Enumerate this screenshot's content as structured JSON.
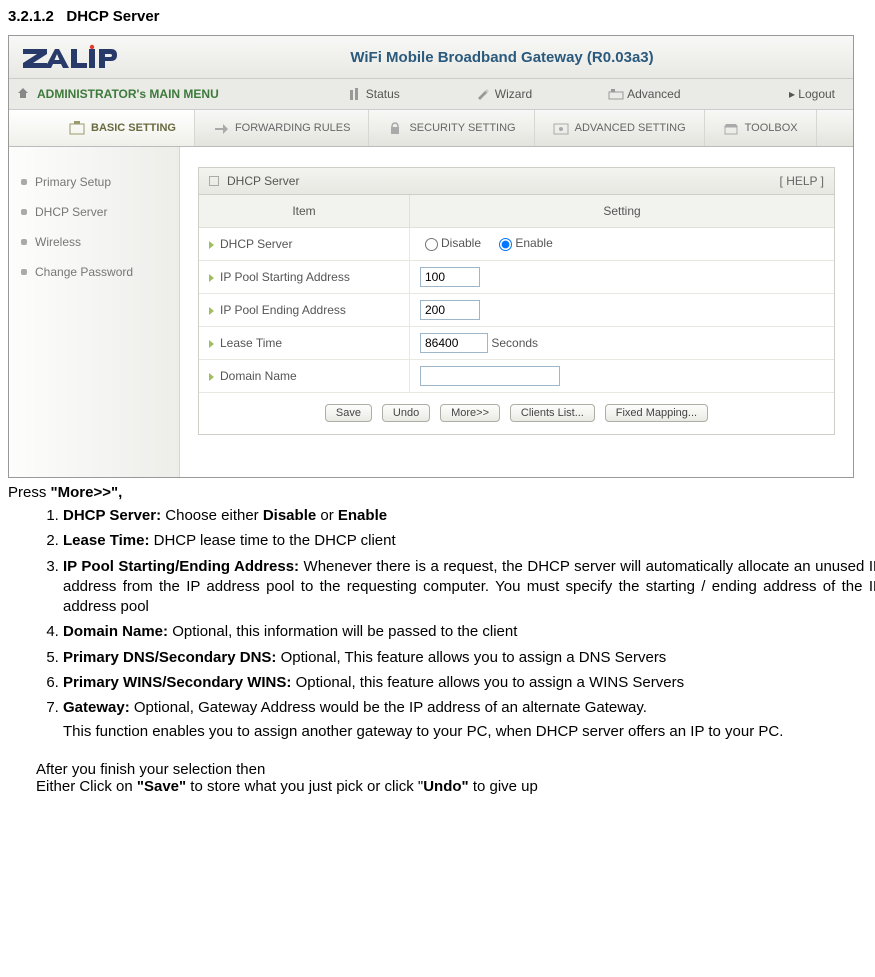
{
  "doc": {
    "section_number": "3.2.1.2",
    "section_name": "DHCP Server",
    "press_prefix": "Press ",
    "press_bold": "\"More>>\",",
    "items": [
      {
        "bold": "DHCP Server:",
        "rest": " Choose either ",
        "bold2": "Disable",
        "mid": " or ",
        "bold3": "Enable"
      },
      {
        "bold": "Lease Time:",
        "rest": " DHCP lease time to the DHCP client"
      },
      {
        "bold": "IP Pool Starting/Ending Address:",
        "rest": " Whenever there is a request, the DHCP server will automatically allocate an unused IP address from the IP address pool to the requesting computer. You must specify the starting / ending address of the IP address pool"
      },
      {
        "bold": "Domain Name:",
        "rest": " Optional, this information will be passed to the client"
      },
      {
        "bold": "Primary DNS/Secondary DNS:",
        "rest": " Optional, This feature allows you to assign a DNS Servers"
      },
      {
        "bold": "Primary WINS/Secondary WINS:",
        "rest": " Optional, this feature allows you to assign a WINS Servers"
      },
      {
        "bold": "Gateway:",
        "rest": " Optional, Gateway Address would be the IP address of an alternate Gateway.",
        "extra": "This function enables you to assign another gateway to your PC, when DHCP server offers an IP to your PC."
      }
    ],
    "finish_line1": "After you finish your selection then",
    "finish_prefix": "Either Click on ",
    "finish_save": "\"Save\"",
    "finish_mid": " to store what you just pick or click \"",
    "finish_undo": "Undo\"",
    "finish_suffix": " to give up"
  },
  "ui": {
    "gateway_title": "WiFi Mobile Broadband Gateway (R0.03a3)",
    "admin_menu": "ADMINISTRATOR's MAIN MENU",
    "nav": {
      "status": "Status",
      "wizard": "Wizard",
      "advanced": "Advanced",
      "logout": "Logout"
    },
    "tabs": {
      "basic": "BASIC SETTING",
      "forwarding": "FORWARDING RULES",
      "security": "SECURITY SETTING",
      "advanced": "ADVANCED SETTING",
      "toolbox": "TOOLBOX"
    },
    "sidebar": {
      "primary": "Primary Setup",
      "dhcp": "DHCP Server",
      "wireless": "Wireless",
      "changepw": "Change Password"
    },
    "panel": {
      "title": "DHCP Server",
      "help": "[ HELP ]",
      "col_item": "Item",
      "col_setting": "Setting",
      "rows": {
        "dhcp_server": "DHCP Server",
        "disable": "Disable",
        "enable": "Enable",
        "ip_start": "IP Pool Starting Address",
        "ip_start_val": "100",
        "ip_end": "IP Pool Ending Address",
        "ip_end_val": "200",
        "lease": "Lease Time",
        "lease_val": "86400",
        "seconds": "Seconds",
        "domain": "Domain Name",
        "domain_val": ""
      },
      "buttons": {
        "save": "Save",
        "undo": "Undo",
        "more": "More>>",
        "clients": "Clients List...",
        "fixed": "Fixed Mapping..."
      }
    }
  }
}
